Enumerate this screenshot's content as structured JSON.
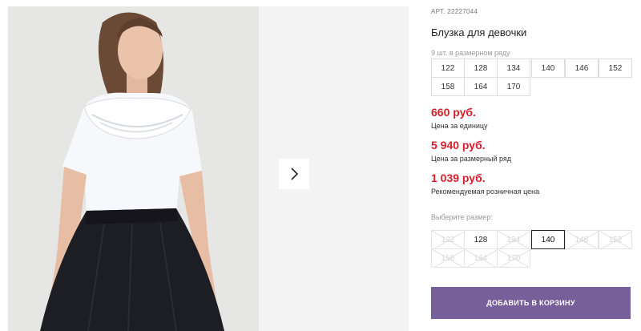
{
  "product": {
    "article_prefix": "АРТ.",
    "article_number": "22227044",
    "title": "Блузка для девочки"
  },
  "size_row": {
    "note": "9 шт. в размерном ряду",
    "sizes": [
      "122",
      "128",
      "134",
      "140",
      "146",
      "152",
      "158",
      "164",
      "170"
    ]
  },
  "prices": [
    {
      "value": "660 руб.",
      "label": "Цена за единицу"
    },
    {
      "value": "5 940 руб.",
      "label": "Цена за размерный ряд"
    },
    {
      "value": "1 039 руб.",
      "label": "Рекомендуемая розничная цена"
    }
  ],
  "size_picker": {
    "label": "Выберите размер:",
    "options": [
      {
        "size": "122",
        "state": "unavailable"
      },
      {
        "size": "128",
        "state": "available"
      },
      {
        "size": "134",
        "state": "unavailable"
      },
      {
        "size": "140",
        "state": "selected"
      },
      {
        "size": "146",
        "state": "unavailable"
      },
      {
        "size": "152",
        "state": "unavailable"
      },
      {
        "size": "158",
        "state": "unavailable"
      },
      {
        "size": "164",
        "state": "unavailable"
      },
      {
        "size": "170",
        "state": "unavailable"
      }
    ]
  },
  "cart_button_label": "ДОБАВИТЬ В КОРЗИНУ",
  "icons": {
    "gallery_next": "chevron-right-icon"
  },
  "colors": {
    "price": "#d71f2b",
    "button": "#775f99",
    "selected_border": "#222222"
  }
}
